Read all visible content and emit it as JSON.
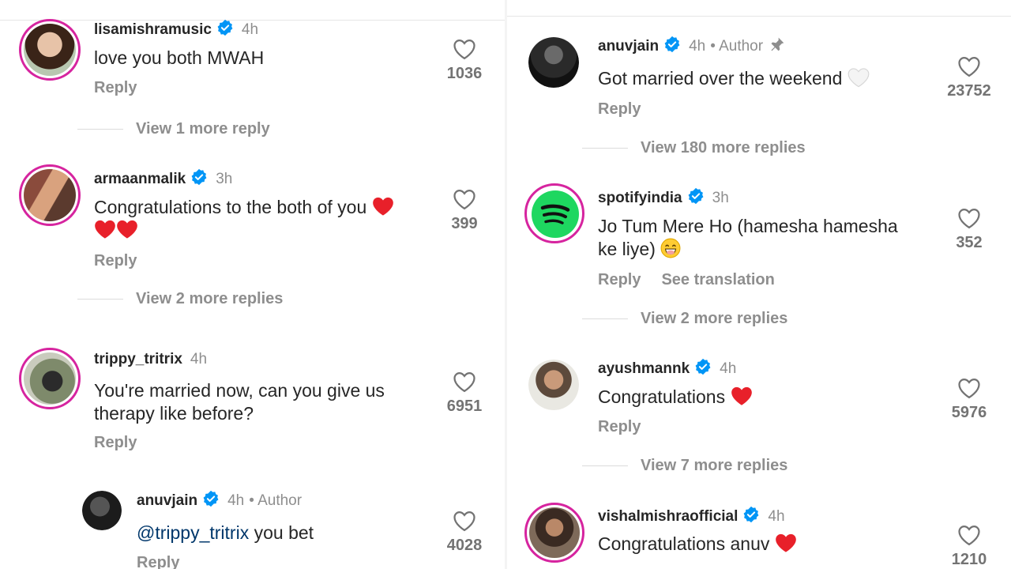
{
  "left": {
    "comments": [
      {
        "username": "lisamishramusic",
        "time": "4h",
        "text": "love you both MWAH",
        "reply": "Reply",
        "likes": "1036",
        "view_more": "View 1 more reply"
      },
      {
        "username": "armaanmalik",
        "time": "3h",
        "text": "Congratulations to the both of you",
        "reply": "Reply",
        "likes": "399",
        "view_more": "View 2 more replies"
      },
      {
        "username": "trippy_tritrix",
        "time": "4h",
        "text_line1": "You're married now, can you give us",
        "text_line2": "therapy like before?",
        "reply": "Reply",
        "likes": "6951"
      },
      {
        "username": "anuvjain",
        "time": "4h",
        "author_tag": "• Author",
        "mention": "@trippy_tritrix",
        "text": "you bet",
        "reply": "Reply",
        "likes": "4028"
      }
    ]
  },
  "right": {
    "comments": [
      {
        "username": "anuvjain",
        "time": "4h",
        "author_tag": "• Author",
        "text": "Got married over the weekend",
        "reply": "Reply",
        "likes": "23752",
        "view_more": "View 180 more replies"
      },
      {
        "username": "spotifyindia",
        "time": "3h",
        "text_line1": "Jo Tum Mere Ho (hamesha hamesha",
        "text_line2": "ke liye)",
        "reply": "Reply",
        "see_translation": "See translation",
        "likes": "352",
        "view_more": "View 2 more replies"
      },
      {
        "username": "ayushmannk",
        "time": "4h",
        "text": "Congratulations",
        "reply": "Reply",
        "likes": "5976",
        "view_more": "View 7 more replies"
      },
      {
        "username": "vishalmishraofficial",
        "time": "4h",
        "text": "Congratulations anuv",
        "likes": "1210"
      }
    ]
  },
  "colors": {
    "verified": "#0095f6",
    "heart_red": "#e8202a",
    "link": "#00376b",
    "meta": "#8e8e8e"
  },
  "icons": [
    "verified-badge-icon",
    "heart-outline-icon",
    "pin-icon",
    "red-heart-emoji",
    "white-heart-emoji",
    "grin-emoji",
    "spotify-logo-icon"
  ]
}
